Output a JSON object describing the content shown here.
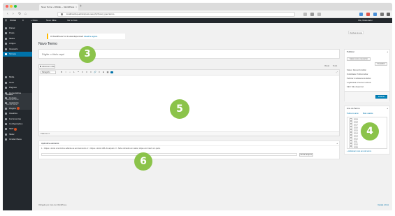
{
  "browser": {
    "tab_title": "Novo Termo ‹ WAGE — WordPress",
    "url": "localhost/wp-admin/post-new.php?post_type=termo"
  },
  "admin_bar": {
    "site_name": "WAGE",
    "comments": "0",
    "new_label": "+ Novo",
    "item1": "Novo Slide",
    "item2": "Ver termos",
    "greeting": "Olá, Moderador"
  },
  "sidebar": {
    "items": [
      {
        "label": "Painel",
        "icon": "dashboard-icon"
      },
      {
        "label": "Posts",
        "icon": "pin-icon"
      },
      {
        "label": "Slides",
        "icon": "slides-icon"
      },
      {
        "label": "Artigos",
        "icon": "articles-icon"
      },
      {
        "label": "Glossário",
        "icon": "book-icon"
      },
      {
        "label": "Termos",
        "icon": "terms-icon",
        "active": true
      },
      {
        "label": "Mídia",
        "icon": "media-icon"
      },
      {
        "label": "Texto",
        "icon": "text-icon"
      },
      {
        "label": "Páginas",
        "icon": "page-icon"
      },
      {
        "label": "Comentários",
        "icon": "comment-icon"
      },
      {
        "label": "Contato",
        "icon": "mail-icon"
      },
      {
        "label": "Aparência",
        "icon": "brush-icon"
      },
      {
        "label": "Plugins",
        "icon": "plugin-icon",
        "badge": "1"
      },
      {
        "label": "Usuários",
        "icon": "users-icon"
      },
      {
        "label": "Ferramentas",
        "icon": "tools-icon"
      },
      {
        "label": "Configurações",
        "icon": "settings-icon"
      },
      {
        "label": "SEO",
        "icon": "seo-icon",
        "badge": "1"
      },
      {
        "label": "Slider",
        "icon": "slider-icon"
      },
      {
        "label": "Ocultar Menu",
        "icon": "collapse-icon"
      }
    ],
    "submenu": {
      "heading": "Termos",
      "add_new": "Adicionar Novo",
      "categories": "Ano do Termo"
    }
  },
  "screen_options": "Opções de tela",
  "notice": {
    "text": "O WordPress 5.2.3 está disponível!",
    "link": "Atualize agora."
  },
  "page_title": "Novo Termo",
  "title_input": {
    "placeholder": "Digite o título aqui"
  },
  "editor": {
    "add_media": "Adicionar mídia",
    "tab_visual": "Visual",
    "tab_text": "Texto",
    "format": "Parágrafo",
    "toolbar_icons": [
      "B",
      "I",
      "•",
      "1.",
      "❝",
      "≡",
      "≡",
      "≡",
      "🔗",
      "≡",
      "⊞",
      "▦",
      "■"
    ],
    "word_count": "Palavras: 0"
  },
  "bottom_box": {
    "title": "Apêndice eleitorais",
    "help_text": "1 - Clique e insira uma título e adiante-se ao documento. 2 - Clique e insira URL do arquivo. 3 - Salve clicando em salvar, clique em Inserir em parte.",
    "button": "Enviar arquivo"
  },
  "publish_box": {
    "title": "Publicar",
    "save_draft": "Salvar como rascunho",
    "preview": "Visualizar",
    "status": "Status: Rascunho Editar",
    "visibility": "Visibilidade: Público Editar",
    "published": "Publicar imediatamente Editar",
    "seo": "Legibilidade: Precisa melhorar",
    "seo2": "SEO: Não disponível",
    "publish_button": "Publicar"
  },
  "year_box": {
    "title": "Ano do Termo",
    "tab_all": "Todos os anos",
    "tab_popular": "Mais usados",
    "years": [
      "2019",
      "2018",
      "2017",
      "2016",
      "2015",
      "2014",
      "2013",
      "2012",
      "2011",
      "2010",
      "2009"
    ],
    "add_new": "+ Adicionar novo ano do termo"
  },
  "footer": {
    "thanks": "Obrigado por criar com WordPress.",
    "version": "Versão 4.9.11"
  },
  "markers": [
    "3",
    "4",
    "5",
    "6"
  ],
  "colors": {
    "admin_dark": "#23282d",
    "wp_blue": "#0073aa",
    "marker_green": "#8bc34a",
    "notice_yellow": "#ffba00"
  }
}
